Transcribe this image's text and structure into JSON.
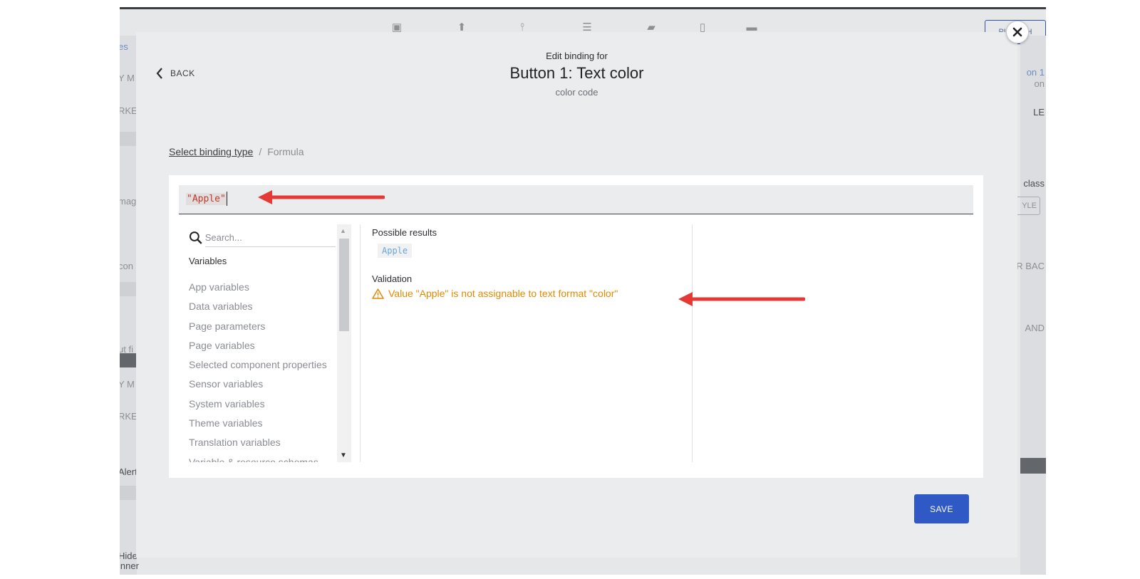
{
  "background_app": {
    "left_texts": [
      "es",
      "Y M",
      "RKET",
      "mag",
      "con",
      "ut fi",
      "Y M",
      "RKET",
      "Alert",
      "Hide",
      "inner"
    ],
    "right_texts": [
      "on 1",
      "on",
      "LE",
      "class",
      "YLE",
      "R BAC",
      "AND"
    ],
    "publish_label": "PUBLISH"
  },
  "modal": {
    "back_label": "BACK",
    "header": {
      "pre": "Edit binding for",
      "title": "Button 1: Text color",
      "subtitle": "color code"
    },
    "breadcrumb": {
      "link": "Select binding type",
      "separator": "/",
      "current": "Formula"
    },
    "formula": {
      "value": "\"Apple\""
    },
    "variables_panel": {
      "search_placeholder": "Search...",
      "heading": "Variables",
      "items": [
        "App variables",
        "Data variables",
        "Page parameters",
        "Page variables",
        "Selected component properties",
        "Sensor variables",
        "System variables",
        "Theme variables",
        "Translation variables",
        "Variable & resource schemas"
      ]
    },
    "results": {
      "label": "Possible results",
      "value": "Apple"
    },
    "validation": {
      "label": "Validation",
      "message": "Value \"Apple\" is not assignable to text format \"color\""
    },
    "save_label": "SAVE"
  },
  "colors": {
    "accent": "#2f59c5",
    "warning": "#e08a00",
    "arrow": "#e53935",
    "formula_text": "#c0392b"
  }
}
